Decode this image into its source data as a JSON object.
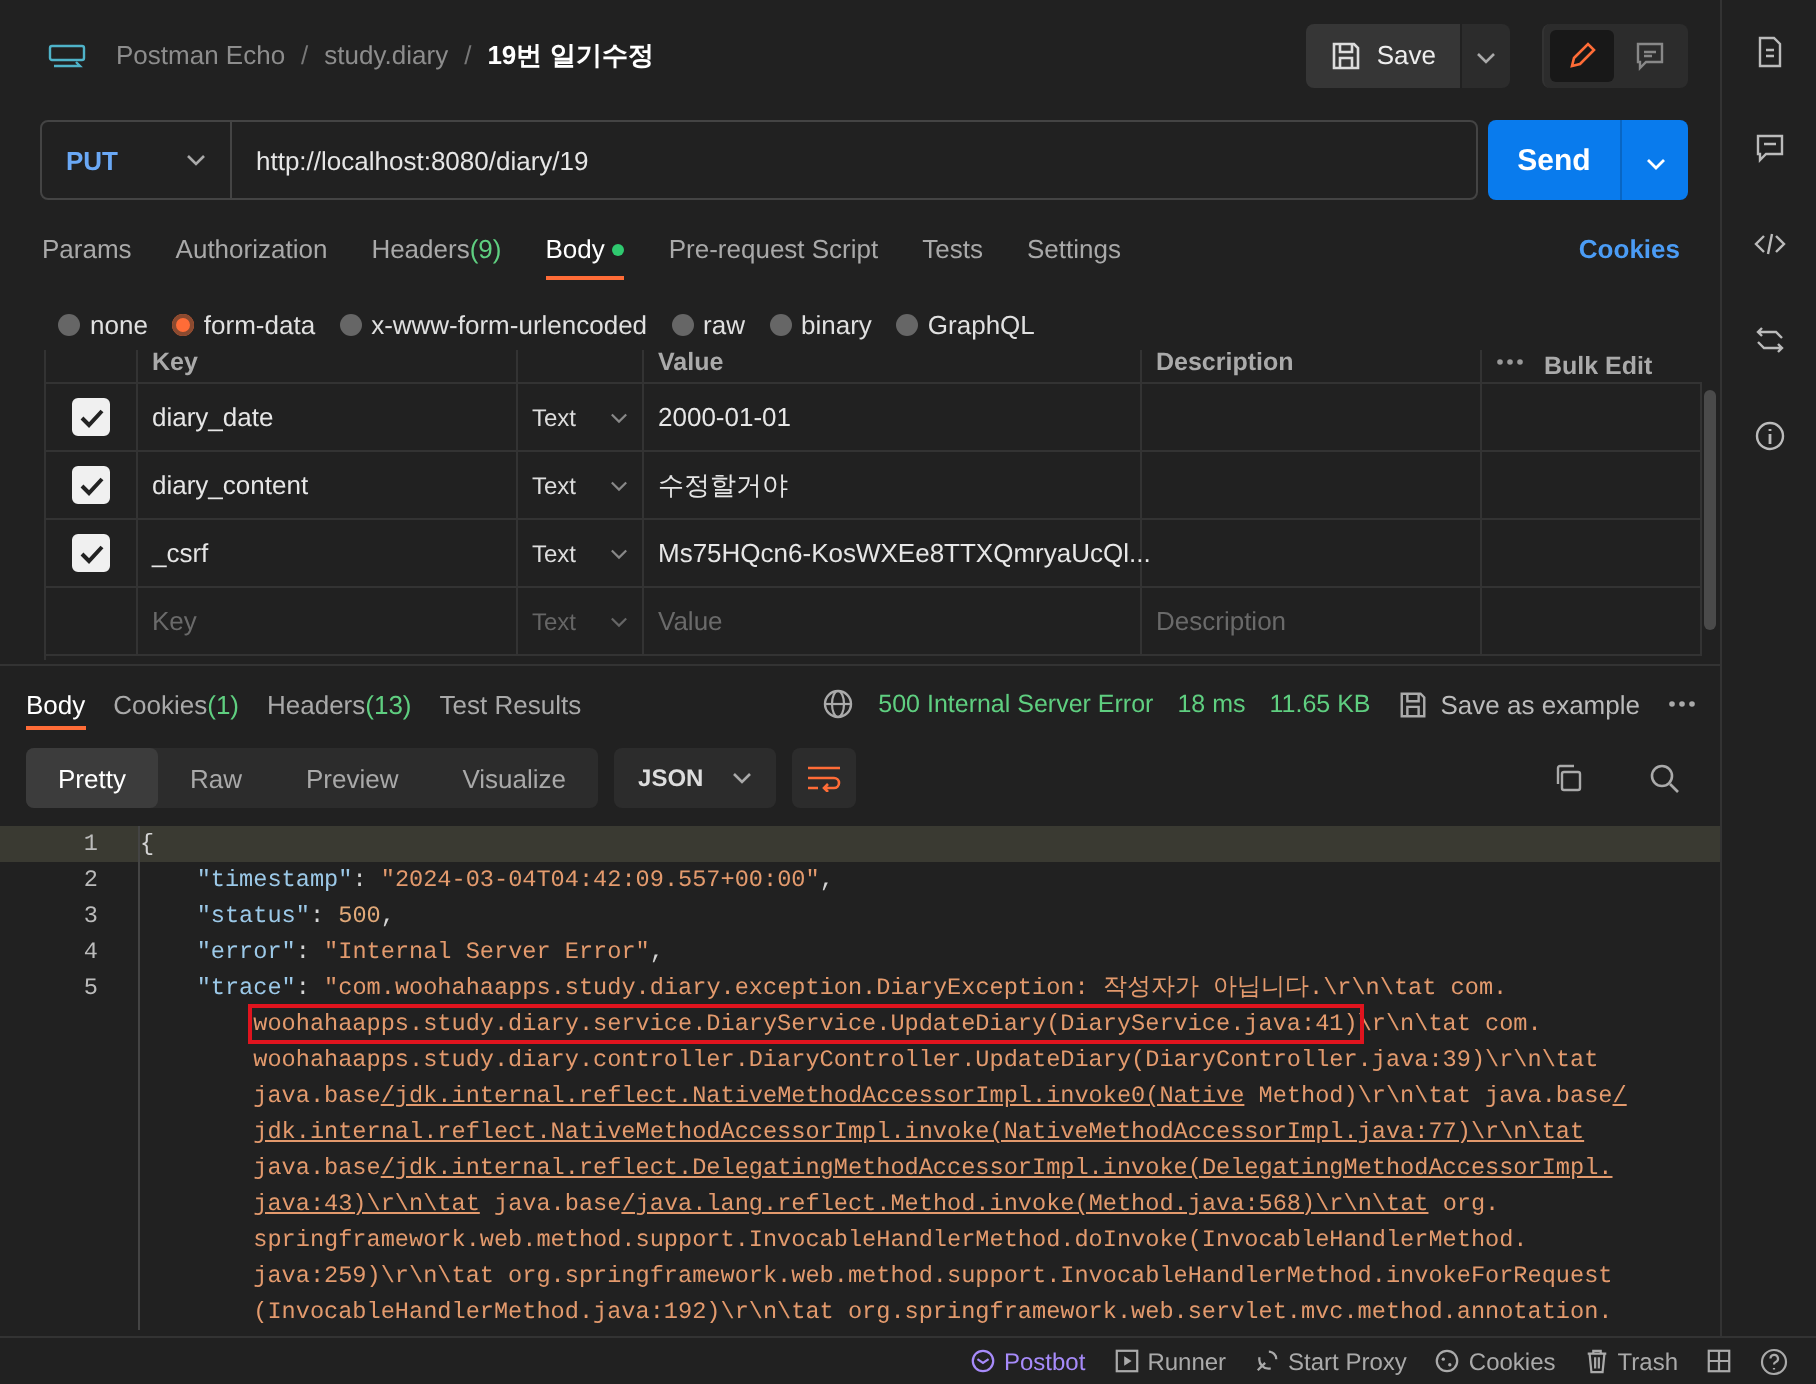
{
  "breadcrumb": [
    {
      "text": "Postman Echo",
      "current": false
    },
    {
      "separator": "/",
      "text": "study.diary",
      "current": false
    },
    {
      "separator": "/",
      "text": "19번 일기수정",
      "current": true
    }
  ],
  "save_label": "Save",
  "request": {
    "method": "PUT",
    "url": "http://localhost:8080/diary/19",
    "send_label": "Send"
  },
  "request_tabs": [
    {
      "label": "Params",
      "selected": false
    },
    {
      "label": "Authorization",
      "selected": false
    },
    {
      "label": "Headers",
      "count": "(9)",
      "selected": false
    },
    {
      "label": "Body",
      "selected": true,
      "dot": true
    },
    {
      "label": "Pre-request Script",
      "selected": false
    },
    {
      "label": "Tests",
      "selected": false
    },
    {
      "label": "Settings",
      "selected": false
    }
  ],
  "cookies_link": "Cookies",
  "body_types": [
    {
      "label": "none",
      "selected": false
    },
    {
      "label": "form-data",
      "selected": true
    },
    {
      "label": "x-www-form-urlencoded",
      "selected": false
    },
    {
      "label": "raw",
      "selected": false
    },
    {
      "label": "binary",
      "selected": false
    },
    {
      "label": "GraphQL",
      "selected": false
    }
  ],
  "params_table": {
    "columns": [
      "Key",
      "Value",
      "Description"
    ],
    "bulk_edit": "Bulk Edit",
    "rows": [
      {
        "checked": true,
        "key": "diary_date",
        "type": "Text",
        "value": "2000-01-01"
      },
      {
        "checked": true,
        "key": "diary_content",
        "type": "Text",
        "value": "수정할거야"
      },
      {
        "checked": true,
        "key": "_csrf",
        "type": "Text",
        "value": "Ms75HQcn6-KosWXEe8TTXQmryaUcQl..."
      }
    ],
    "new_row": {
      "key": {
        "placeholder": "Key"
      },
      "type": "Text",
      "value": {
        "placeholder": "Value"
      },
      "description": {
        "placeholder": "Description"
      }
    }
  },
  "response_tabs": [
    {
      "label": "Body",
      "selected": true
    },
    {
      "label": "Cookies",
      "count": "(1)",
      "selected": false
    },
    {
      "label": "Headers",
      "count": "(13)",
      "selected": false
    },
    {
      "label": "Test Results",
      "selected": false
    }
  ],
  "response_meta": {
    "status": "500 Internal Server Error",
    "time": "18 ms",
    "size": "11.65 KB",
    "save_example": "Save as example"
  },
  "view_modes": [
    {
      "label": "Pretty",
      "selected": true
    },
    {
      "label": "Raw",
      "selected": false
    },
    {
      "label": "Preview",
      "selected": false
    },
    {
      "label": "Visualize",
      "selected": false
    }
  ],
  "format": "JSON",
  "code_lines": [
    {
      "number": "1",
      "current": true,
      "kind": "brace",
      "parts": [
        {
          "kind": "punct",
          "text": "{"
        }
      ]
    },
    {
      "number": "2",
      "current": false,
      "kind": "property",
      "parts": [
        {
          "kind": "key",
          "text": "\"timestamp\""
        },
        {
          "kind": "punct",
          "text": ": "
        },
        {
          "kind": "string",
          "text": "\"2024-03-04T04:42:09.557+00:00\""
        },
        {
          "kind": "punct",
          "text": ","
        }
      ]
    },
    {
      "number": "3",
      "current": false,
      "kind": "property",
      "parts": [
        {
          "kind": "key",
          "text": "\"status\""
        },
        {
          "kind": "punct",
          "text": ": "
        },
        {
          "kind": "number",
          "text": "500"
        },
        {
          "kind": "punct",
          "text": ","
        }
      ]
    },
    {
      "number": "4",
      "current": false,
      "kind": "property",
      "parts": [
        {
          "kind": "key",
          "text": "\"error\""
        },
        {
          "kind": "punct",
          "text": ": "
        },
        {
          "kind": "string",
          "text": "\"Internal Server Error\""
        },
        {
          "kind": "punct",
          "text": ","
        }
      ]
    },
    {
      "number": "5",
      "current": false,
      "kind": "property",
      "parts": [
        {
          "kind": "key",
          "text": "\"trace\""
        },
        {
          "kind": "punct",
          "text": ": "
        },
        {
          "kind": "string",
          "text": "\"com.woohahaapps.study.diary.exception.DiaryException: 작성자가 아닙니다.\\r\\n\\tat com."
        }
      ]
    },
    {
      "current": false,
      "kind": "wrap",
      "parts": [
        {
          "kind": "boxed",
          "text": "woohahaapps.study.diary.service.DiaryService.UpdateDiary(DiaryService.java:41)"
        },
        {
          "kind": "string",
          "text": "\\r\\n\\tat com."
        }
      ]
    },
    {
      "current": false,
      "kind": "wrap",
      "parts": [
        {
          "kind": "string",
          "text": "woohahaapps.study.diary.controller.DiaryController.UpdateDiary(DiaryController.java:39)\\r\\n\\tat"
        }
      ]
    },
    {
      "current": false,
      "kind": "wrap",
      "parts": [
        {
          "kind": "string",
          "text": "java.base"
        },
        {
          "kind": "link",
          "text": "/jdk.internal.reflect.NativeMethodAccessorImpl.invoke0(Native"
        },
        {
          "kind": "string",
          "text": " Method)\\r\\n\\tat java.base"
        },
        {
          "kind": "link",
          "text": "/"
        }
      ]
    },
    {
      "current": false,
      "kind": "wrap",
      "parts": [
        {
          "kind": "link",
          "text": "jdk.internal.reflect.NativeMethodAccessorImpl.invoke(NativeMethodAccessorImpl.java:77)\\r\\n\\tat"
        }
      ]
    },
    {
      "current": false,
      "kind": "wrap",
      "parts": [
        {
          "kind": "string",
          "text": "java.base"
        },
        {
          "kind": "link",
          "text": "/jdk.internal.reflect.DelegatingMethodAccessorImpl.invoke(DelegatingMethodAccessorImpl."
        }
      ]
    },
    {
      "current": false,
      "kind": "wrap",
      "parts": [
        {
          "kind": "link",
          "text": "java:43)\\r\\n\\tat"
        },
        {
          "kind": "string",
          "text": " java.base"
        },
        {
          "kind": "link",
          "text": "/java.lang.reflect.Method.invoke(Method.java:568)\\r\\n\\tat"
        },
        {
          "kind": "string",
          "text": " org."
        }
      ]
    },
    {
      "current": false,
      "kind": "wrap",
      "parts": [
        {
          "kind": "string",
          "text": "springframework.web.method.support.InvocableHandlerMethod.doInvoke(InvocableHandlerMethod."
        }
      ]
    },
    {
      "current": false,
      "kind": "wrap",
      "parts": [
        {
          "kind": "string",
          "text": "java:259)\\r\\n\\tat org.springframework.web.method.support.InvocableHandlerMethod.invokeForRequest"
        }
      ]
    },
    {
      "current": false,
      "kind": "wrap",
      "parts": [
        {
          "kind": "string",
          "text": "(InvocableHandlerMethod.java:192)\\r\\n\\tat org.springframework.web.servlet.mvc.method.annotation."
        }
      ]
    }
  ],
  "status_bar": [
    {
      "label": "Postbot",
      "kind": "postbot"
    },
    {
      "label": "Runner",
      "kind": "runner"
    },
    {
      "label": "Start Proxy",
      "kind": "proxy"
    },
    {
      "label": "Cookies",
      "kind": "cookies"
    },
    {
      "label": "Trash",
      "kind": "trash"
    }
  ]
}
